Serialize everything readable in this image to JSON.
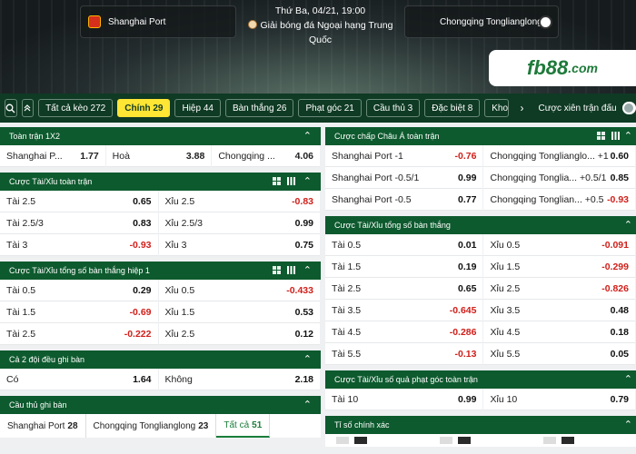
{
  "match": {
    "date_time": "Thứ Ba, 04/21, 19:00",
    "league": "Giải bóng đá Ngoại hạng Trung Quốc",
    "home": "Shanghai Port",
    "away": "Chongqing Tonglianglong",
    "home_crest_icon": "shanghai-port-crest-icon",
    "away_crest_icon": "soccer-ball-icon"
  },
  "brand": {
    "logo_main": "fb88",
    "logo_suffix": ".com",
    "color": "#1e7a3a"
  },
  "filters": {
    "search_icon": "search-icon",
    "collapse_icon": "double-chevron-up-icon",
    "items": [
      {
        "label": "Tất cả kèo",
        "count": "272"
      },
      {
        "label": "Chính",
        "count": "29",
        "active": true
      },
      {
        "label": "Hiệp",
        "count": "44"
      },
      {
        "label": "Bàn thắng",
        "count": "26"
      },
      {
        "label": "Phạt góc",
        "count": "21"
      },
      {
        "label": "Cầu thủ",
        "count": "3"
      },
      {
        "label": "Đặc biệt",
        "count": "8"
      },
      {
        "label": "Khoảng",
        "count": ""
      }
    ],
    "next_icon": "chevron-right-icon",
    "toggle_label": "Cược xiên trận đấu"
  },
  "colors": {
    "header_green": "#0d5a2e",
    "filter_bg": "#0f3a24",
    "active_yellow": "#ffe534",
    "negative": "#d0201b"
  },
  "left": {
    "fulltime_1x2": {
      "title": "Toàn trận 1X2",
      "row": [
        {
          "label": "Shanghai P...",
          "odd": "1.77"
        },
        {
          "label": "Hoà",
          "odd": "3.88"
        },
        {
          "label": "Chongqing ...",
          "odd": "4.06"
        }
      ]
    },
    "over_under_ft": {
      "title": "Cược Tài/Xỉu toàn trận",
      "rows": [
        [
          {
            "label": "Tài 2.5",
            "odd": "0.65",
            "neg": false
          },
          {
            "label": "Xỉu 2.5",
            "odd": "-0.83",
            "neg": true
          }
        ],
        [
          {
            "label": "Tài 2.5/3",
            "odd": "0.83",
            "neg": false
          },
          {
            "label": "Xỉu 2.5/3",
            "odd": "0.99",
            "neg": false
          }
        ],
        [
          {
            "label": "Tài 3",
            "odd": "-0.93",
            "neg": true
          },
          {
            "label": "Xỉu 3",
            "odd": "0.75",
            "neg": false
          }
        ]
      ]
    },
    "over_under_h1": {
      "title": "Cược Tài/Xỉu tổng số bàn thắng hiệp 1",
      "rows": [
        [
          {
            "label": "Tài 0.5",
            "odd": "0.29",
            "neg": false
          },
          {
            "label": "Xỉu 0.5",
            "odd": "-0.433",
            "neg": true
          }
        ],
        [
          {
            "label": "Tài 1.5",
            "odd": "-0.69",
            "neg": true
          },
          {
            "label": "Xỉu 1.5",
            "odd": "0.53",
            "neg": false
          }
        ],
        [
          {
            "label": "Tài 2.5",
            "odd": "-0.222",
            "neg": true
          },
          {
            "label": "Xỉu 2.5",
            "odd": "0.12",
            "neg": false
          }
        ]
      ]
    },
    "btts": {
      "title": "Cả 2 đội đều ghi bàn",
      "row": [
        {
          "label": "Có",
          "odd": "1.64"
        },
        {
          "label": "Không",
          "odd": "2.18"
        }
      ]
    },
    "scorer": {
      "title": "Cầu thủ ghi bàn",
      "tabs": [
        {
          "label": "Shanghai Port",
          "count": "28"
        },
        {
          "label": "Chongqing Tonglianglong",
          "count": "23"
        },
        {
          "label": "Tất cả",
          "count": "51",
          "active": true
        }
      ]
    }
  },
  "right": {
    "asian_handicap": {
      "title": "Cược chấp Châu Á toàn trận",
      "rows": [
        [
          {
            "label": "Shanghai Port -1",
            "odd": "-0.76",
            "neg": true
          },
          {
            "label": "Chongqing Tonglianglo... +1",
            "odd": "0.60",
            "neg": false
          }
        ],
        [
          {
            "label": "Shanghai Port -0.5/1",
            "odd": "0.99",
            "neg": false
          },
          {
            "label": "Chongqing Tonglia... +0.5/1",
            "odd": "0.85",
            "neg": false
          }
        ],
        [
          {
            "label": "Shanghai Port -0.5",
            "odd": "0.77",
            "neg": false
          },
          {
            "label": "Chongqing Tonglian... +0.5",
            "odd": "-0.93",
            "neg": true
          }
        ]
      ]
    },
    "over_under_goals": {
      "title": "Cược Tài/Xỉu tổng số bàn thắng",
      "rows": [
        [
          {
            "label": "Tài 0.5",
            "odd": "0.01",
            "neg": false
          },
          {
            "label": "Xỉu 0.5",
            "odd": "-0.091",
            "neg": true
          }
        ],
        [
          {
            "label": "Tài 1.5",
            "odd": "0.19",
            "neg": false
          },
          {
            "label": "Xỉu 1.5",
            "odd": "-0.299",
            "neg": true
          }
        ],
        [
          {
            "label": "Tài 2.5",
            "odd": "0.65",
            "neg": false
          },
          {
            "label": "Xỉu 2.5",
            "odd": "-0.826",
            "neg": true
          }
        ],
        [
          {
            "label": "Tài 3.5",
            "odd": "-0.645",
            "neg": true
          },
          {
            "label": "Xỉu 3.5",
            "odd": "0.48",
            "neg": false
          }
        ],
        [
          {
            "label": "Tài 4.5",
            "odd": "-0.286",
            "neg": true
          },
          {
            "label": "Xỉu 4.5",
            "odd": "0.18",
            "neg": false
          }
        ],
        [
          {
            "label": "Tài 5.5",
            "odd": "-0.13",
            "neg": true
          },
          {
            "label": "Xỉu 5.5",
            "odd": "0.05",
            "neg": false
          }
        ]
      ]
    },
    "corners": {
      "title": "Cược Tài/Xỉu số quả phạt góc toàn trận",
      "rows": [
        [
          {
            "label": "Tài 10",
            "odd": "0.99",
            "neg": false
          },
          {
            "label": "Xỉu 10",
            "odd": "0.79",
            "neg": false
          }
        ]
      ]
    },
    "correct_score": {
      "title": "Tỉ số chính xác"
    }
  }
}
